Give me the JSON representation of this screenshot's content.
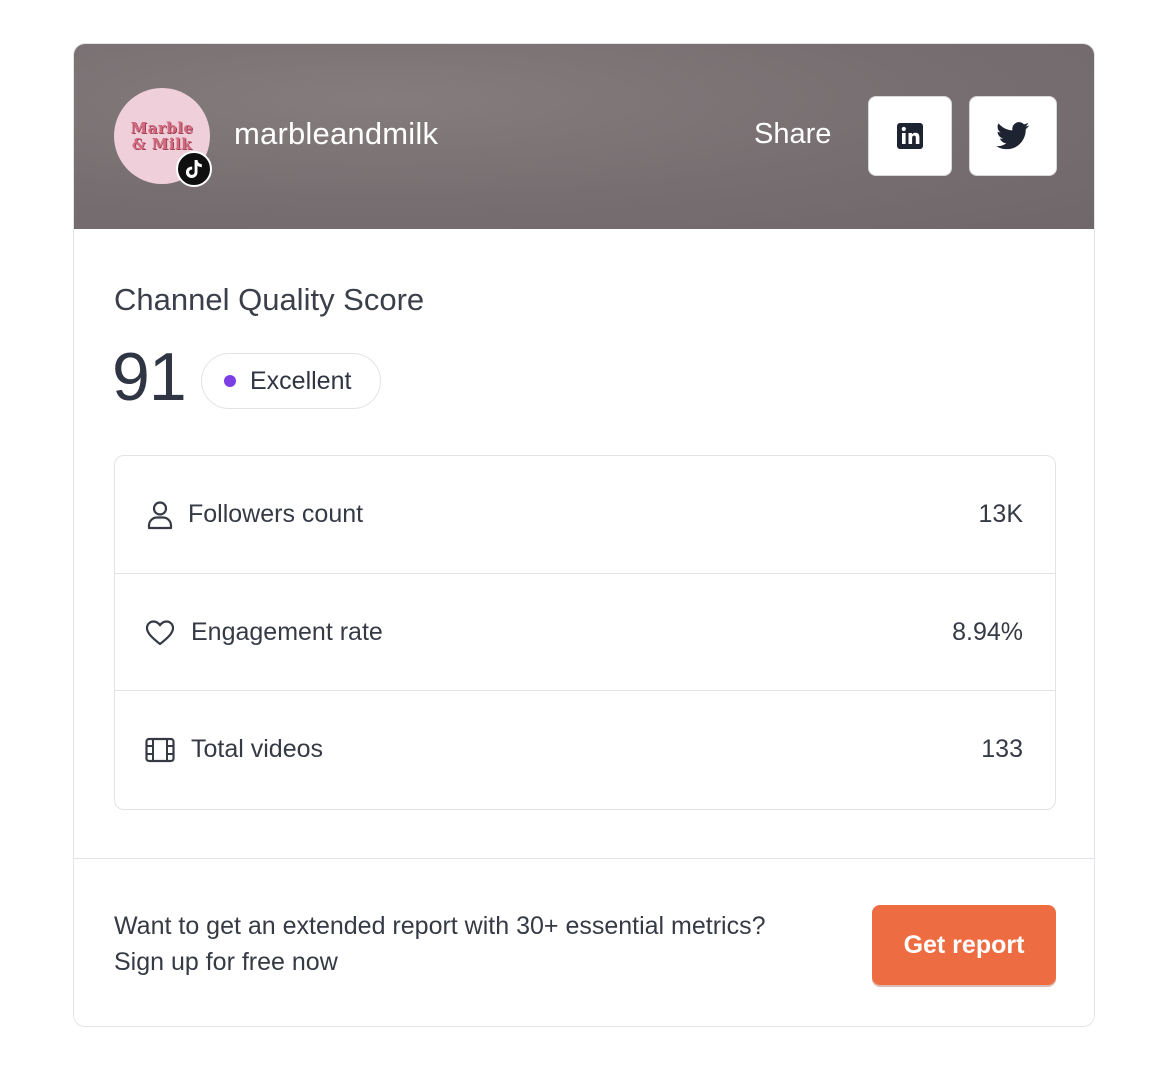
{
  "profile": {
    "username": "marbleandmilk",
    "avatar_logo_lines": [
      "Marble",
      "& Milk"
    ],
    "platform_icon": "tiktok-icon"
  },
  "share": {
    "label": "Share",
    "buttons": [
      {
        "name": "linkedin",
        "icon": "linkedin-icon"
      },
      {
        "name": "twitter",
        "icon": "twitter-icon"
      }
    ]
  },
  "score": {
    "title": "Channel Quality Score",
    "value": "91",
    "status": "Excellent",
    "status_color": "#7b3fe4"
  },
  "metrics": [
    {
      "label": "Followers count",
      "value": "13K",
      "icon": "user-icon"
    },
    {
      "label": "Engagement rate",
      "value": "8.94%",
      "icon": "heart-icon"
    },
    {
      "label": "Total videos",
      "value": "133",
      "icon": "film-icon"
    }
  ],
  "cta": {
    "line1": "Want to get an extended report with 30+ essential metrics?",
    "line2": "Sign up for free now",
    "button_label": "Get report",
    "button_color": "#ee6c42"
  }
}
